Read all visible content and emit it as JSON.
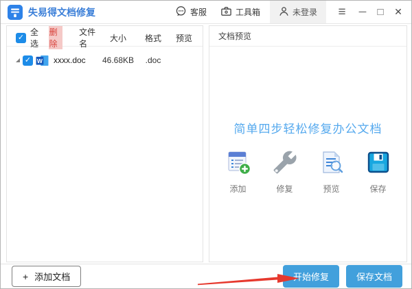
{
  "window": {
    "title": "失易得文档修复"
  },
  "titlebar": {
    "service": "客服",
    "toolbox": "工具箱",
    "login": "未登录"
  },
  "icons": {
    "check": "✓",
    "menu": "≡",
    "minimize": "─",
    "maximize": "□",
    "close": "✕",
    "plus": "+"
  },
  "file_panel": {
    "select_all": "全选",
    "delete": "删除",
    "col_name": "文件名",
    "col_size": "大小",
    "col_format": "格式",
    "col_preview": "预览",
    "rows": [
      {
        "name": "xxxx.doc",
        "size": "46.68KB",
        "format": ".doc"
      }
    ]
  },
  "preview_panel": {
    "title": "文档预览",
    "headline": "简单四步轻松修复办公文档",
    "steps": [
      {
        "label": "添加"
      },
      {
        "label": "修复"
      },
      {
        "label": "预览"
      },
      {
        "label": "保存"
      }
    ]
  },
  "footer": {
    "add_label": "添加文档",
    "start_repair": "开始修复",
    "save_doc": "保存文档"
  },
  "colors": {
    "accent_blue": "#42a0dc",
    "title_blue": "#3b7fd8",
    "headline_blue": "#55a9ee",
    "checkbox_blue": "#1d8ce8",
    "delete_red": "#d8433c",
    "arrow_red": "#e6392e"
  }
}
